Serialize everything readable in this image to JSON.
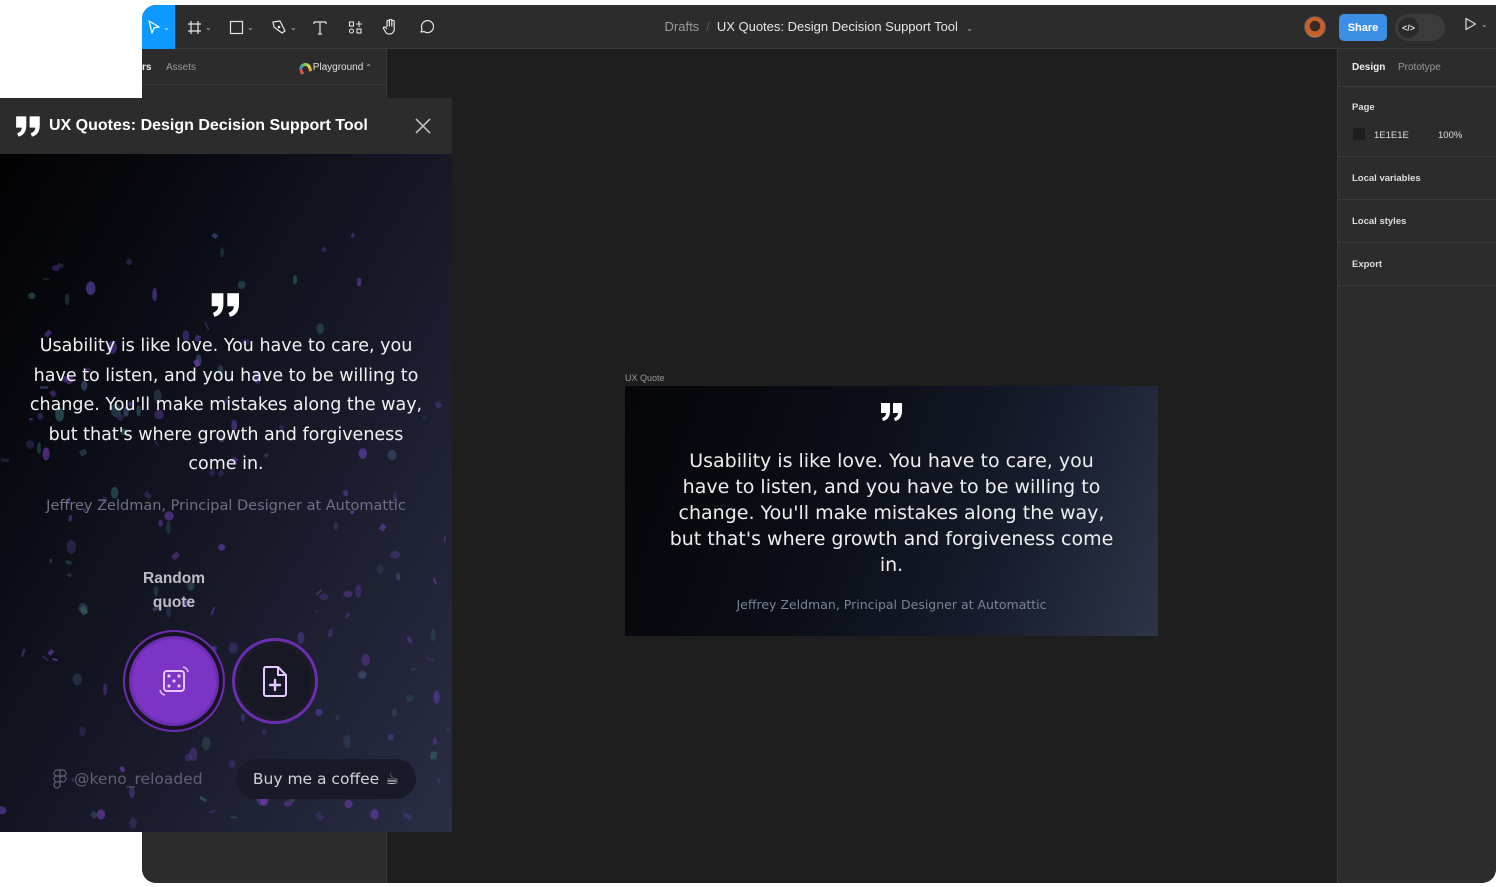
{
  "toolbar": {
    "tools": [
      {
        "name": "move-tool",
        "icon": "cursor-icon"
      },
      {
        "name": "frame-tool",
        "icon": "frame-icon"
      },
      {
        "name": "shape-tool",
        "icon": "rectangle-icon"
      },
      {
        "name": "pen-tool",
        "icon": "pen-icon"
      },
      {
        "name": "text-tool",
        "icon": "text-icon"
      },
      {
        "name": "resources-tool",
        "icon": "components-icon"
      },
      {
        "name": "hand-tool",
        "icon": "hand-icon"
      },
      {
        "name": "comment-tool",
        "icon": "comment-icon"
      }
    ],
    "breadcrumb": {
      "parent": "Drafts",
      "separator": "/",
      "file_name": "UX Quotes: Design Decision Support Tool"
    },
    "share_label": "Share",
    "dev_mode_label": "</>",
    "accent_color": "#0d99ff"
  },
  "left_panel": {
    "tabs": [
      {
        "label": "Layers",
        "visible_text": "rs"
      },
      {
        "label": "Assets"
      }
    ],
    "page_selector": "Playground"
  },
  "canvas": {
    "background": "#1E1E1E",
    "frame": {
      "label": "UX Quote",
      "quote": "Usability is like love. You have to care, you have to listen, and you have to be willing to change. You'll make mistakes along the way, but that's where growth and forgiveness come in.",
      "author": "Jeffrey Zeldman, Principal Designer at Automattic"
    }
  },
  "right_panel": {
    "tabs": [
      {
        "label": "Design",
        "active": true
      },
      {
        "label": "Prototype",
        "active": false
      }
    ],
    "page_section": {
      "title": "Page",
      "color_hex": "1E1E1E",
      "opacity": "100%"
    },
    "sections": [
      "Local variables",
      "Local styles",
      "Export"
    ]
  },
  "plugin": {
    "title": "UX Quotes: Design Decision Support Tool",
    "quote": "Usability is like love. You have to care, you have to listen, and you have to be willing to change. You'll make mistakes along the way, but that's where growth and forgiveness come in.",
    "author": "Jeffrey Zeldman, Principal Designer at Automattic",
    "random_label": "Random quote",
    "random_button_icon": "dice-icon",
    "insert_button_icon": "file-plus-icon",
    "figma_handle": "@keno_reloaded",
    "coffee_label": "Buy me a coffee",
    "coffee_emoji": "☕",
    "accent_color": "#7b34c4"
  }
}
